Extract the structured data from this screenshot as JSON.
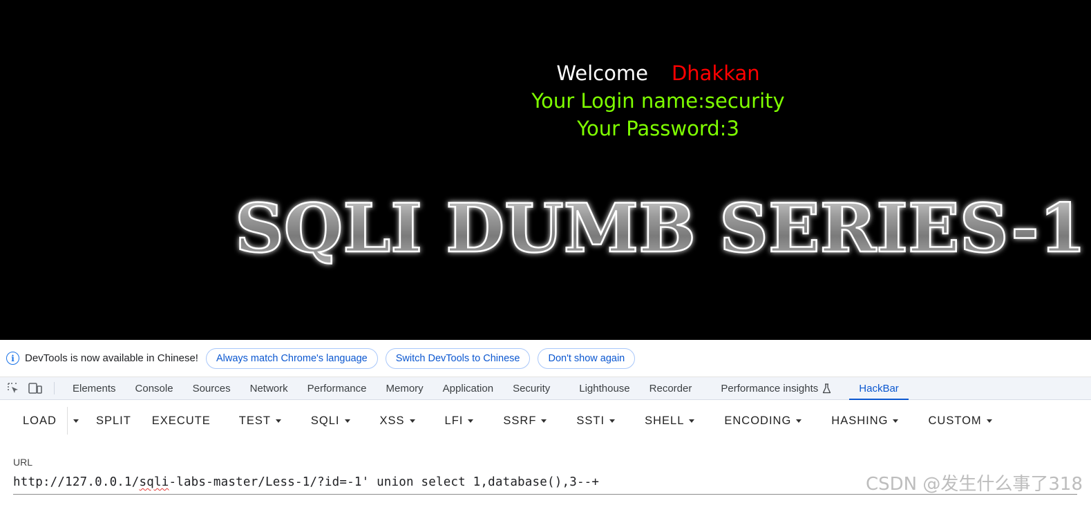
{
  "page": {
    "welcome_word": "Welcome",
    "welcome_name": "Dhakkan",
    "login_line": "Your Login name:security",
    "password_line": "Your Password:3",
    "banner_text": "SQLI DUMB SERIES-1"
  },
  "infobar": {
    "message": "DevTools is now available in Chinese!",
    "buttons": [
      "Always match Chrome's language",
      "Switch DevTools to Chinese",
      "Don't show again"
    ]
  },
  "devtools_tabs": [
    "Elements",
    "Console",
    "Sources",
    "Network",
    "Performance",
    "Memory",
    "Application",
    "Security",
    "Lighthouse",
    "Recorder",
    "Performance insights",
    "HackBar"
  ],
  "active_tab": "HackBar",
  "hackbar": {
    "load": "LOAD",
    "split": "SPLIT",
    "execute": "EXECUTE",
    "menus": [
      "TEST",
      "SQLI",
      "XSS",
      "LFI",
      "SSRF",
      "SSTI",
      "SHELL",
      "ENCODING",
      "HASHING",
      "CUSTOM"
    ]
  },
  "url": {
    "label": "URL",
    "value_prefix": "http://127.0.0.1/",
    "value_spell": "sqli",
    "value_suffix": "-labs-master/Less-1/?id=-1' union select 1,database(),3--+"
  },
  "watermark": "CSDN @发生什么事了318",
  "colors": {
    "accent": "#0b57d0",
    "login_green": "#7fff00",
    "welcome_red": "#ff0000"
  }
}
